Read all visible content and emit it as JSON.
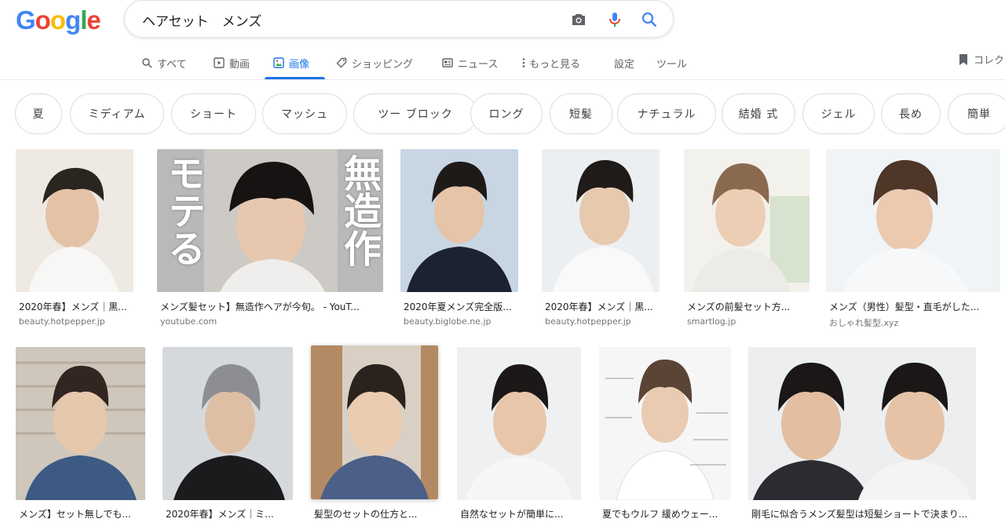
{
  "logo": {
    "letters": [
      "G",
      "o",
      "o",
      "g",
      "l",
      "e"
    ],
    "colors": [
      "#4285F4",
      "#EA4335",
      "#FBBC05",
      "#4285F4",
      "#34A853",
      "#EA4335"
    ]
  },
  "search": {
    "query": "ヘアセット　メンズ",
    "icons": [
      "camera-icon",
      "microphone-icon",
      "search-icon"
    ]
  },
  "tabs": [
    {
      "label": "すべて",
      "icon": "search-icon"
    },
    {
      "label": "動画",
      "icon": "video-icon"
    },
    {
      "label": "画像",
      "icon": "image-icon",
      "active": true
    },
    {
      "label": "ショッピング",
      "icon": "tag-icon"
    },
    {
      "label": "ニュース",
      "icon": "news-icon"
    },
    {
      "label": "もっと見る",
      "icon": "more-vert-icon"
    },
    {
      "label": "設定"
    },
    {
      "label": "ツール"
    }
  ],
  "collection": {
    "label": "コレク",
    "icon": "bookmark-icon"
  },
  "chips": [
    "夏",
    "ミディアム",
    "ショート",
    "マッシュ",
    "ツー ブロック",
    "ロング",
    "短髪",
    "ナチュラル",
    "結婚 式",
    "ジェル",
    "長め",
    "簡単"
  ],
  "results_row1": [
    {
      "title": "2020年春】メンズ｜黒...",
      "site": "beauty.hotpepper.jp"
    },
    {
      "title": "メンズ髪セット】無造作ヘアが今旬。 - YouT...",
      "site": "youtube.com",
      "overlay_left": "モテる",
      "overlay_right": "無造作"
    },
    {
      "title": "2020年夏メンズ完全版...",
      "site": "beauty.biglobe.ne.jp"
    },
    {
      "title": "2020年春】メンズ｜黒...",
      "site": "beauty.hotpepper.jp"
    },
    {
      "title": "メンズの前髪セット方...",
      "site": "smartlog.jp"
    },
    {
      "title": "メンズ（男性）髪型・直毛がした...",
      "site": "おしゃれ髪型.xyz"
    }
  ],
  "results_row2": [
    {
      "title": "メンズ】セット無しでも..."
    },
    {
      "title": "2020年春】メンズ｜ミ..."
    },
    {
      "title": "髪型のセットの仕方と..."
    },
    {
      "title": "自然なセットが簡単に..."
    },
    {
      "title": "夏でもウルフ 緩めウェー..."
    },
    {
      "title": "剛毛に似合うメンズ髪型は短髪ショートで決まり..."
    }
  ],
  "colors": {
    "accent": "#1a73e8",
    "muted": "#5f6368",
    "site": "#70757a"
  }
}
